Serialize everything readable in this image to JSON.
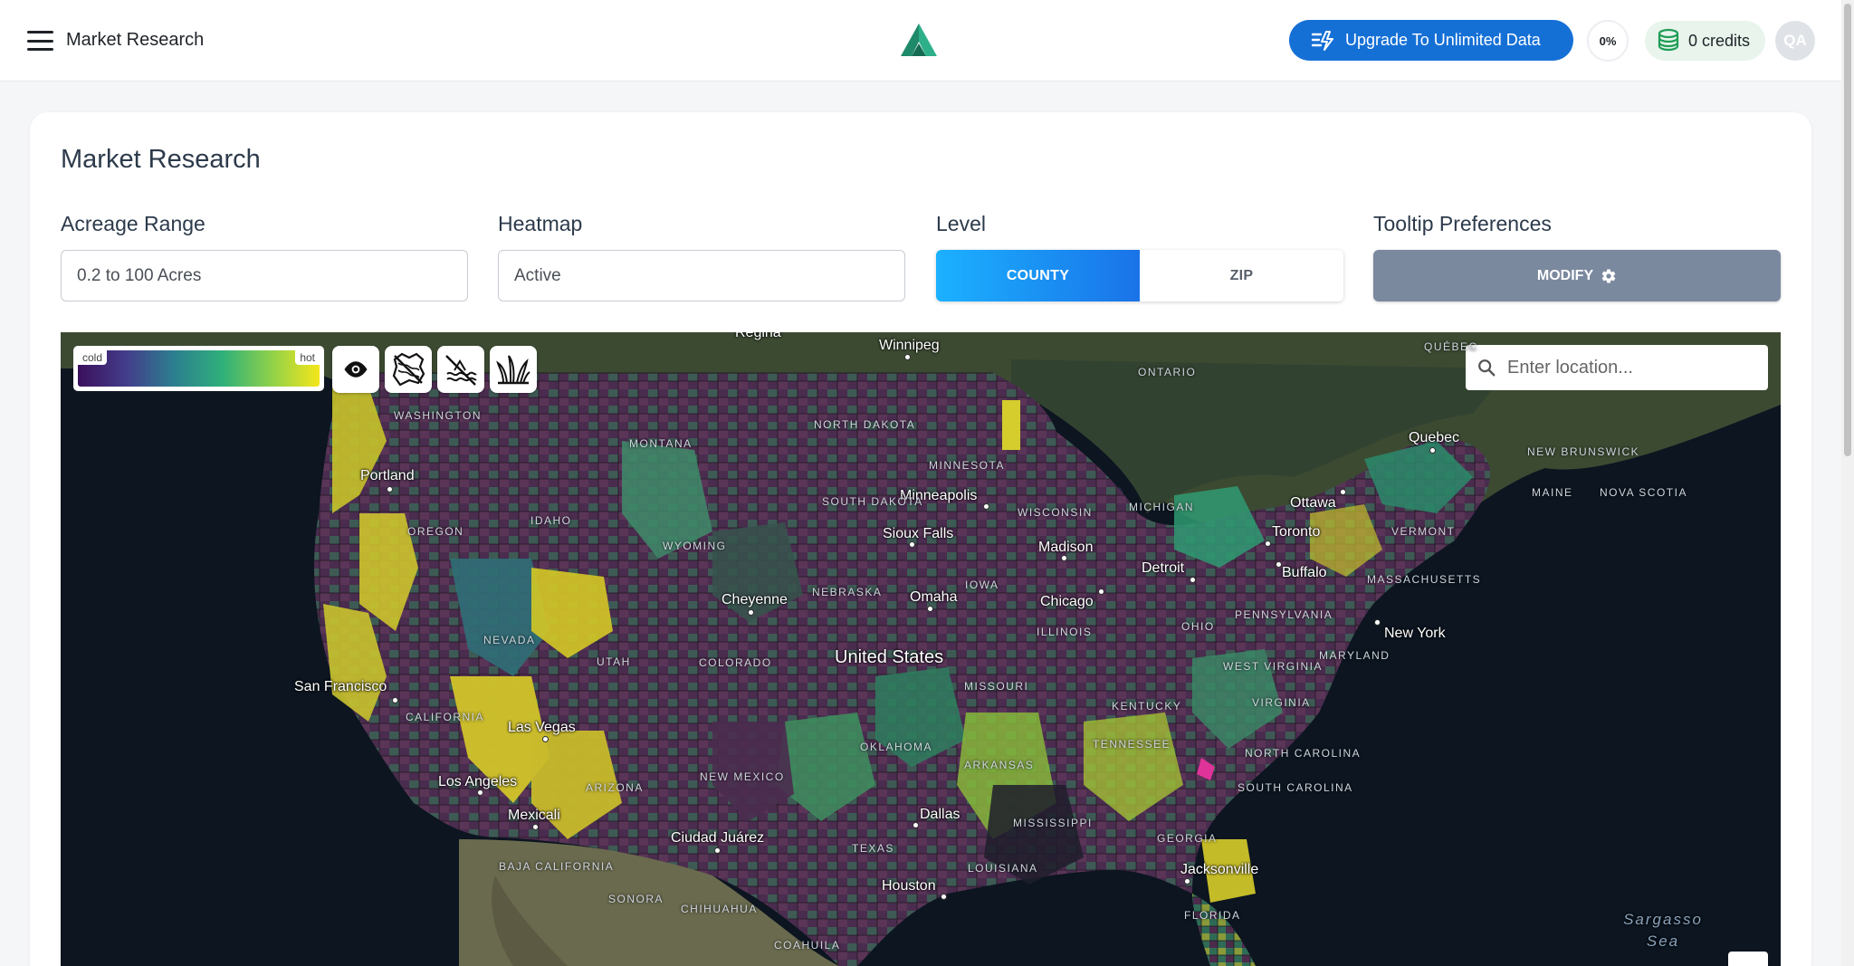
{
  "header": {
    "app_title": "Market Research",
    "upgrade_label": "Upgrade To Unlimited Data",
    "progress_text": "0%",
    "progress_value": 0,
    "credits_label": "0 credits",
    "avatar_initials": "QA"
  },
  "page": {
    "title": "Market Research"
  },
  "filters": {
    "acreage": {
      "label": "Acreage Range",
      "value": "0.2 to 100 Acres"
    },
    "heatmap": {
      "label": "Heatmap",
      "value": "Active"
    },
    "level": {
      "label": "Level",
      "options": [
        "COUNTY",
        "ZIP"
      ],
      "selected": "COUNTY"
    },
    "tooltip": {
      "label": "Tooltip Preferences",
      "button_label": "MODIFY"
    }
  },
  "map": {
    "legend": {
      "cold_label": "cold",
      "hot_label": "hot"
    },
    "layer_icons": [
      "eye-icon",
      "no-flood-zone-icon",
      "no-wetland-icon",
      "vegetation-icon"
    ],
    "search_placeholder": "Enter location...",
    "country_label": "United States",
    "cities": [
      "Regina",
      "Winnipeg",
      "Portland",
      "Minneapolis",
      "Sioux Falls",
      "Madison",
      "Ottawa",
      "Quebec",
      "Toronto",
      "Buffalo",
      "Detroit",
      "Chicago",
      "Omaha",
      "Cheyenne",
      "New York",
      "San Francisco",
      "Las Vegas",
      "Los Angeles",
      "Mexicali",
      "Ciudad Juárez",
      "Dallas",
      "Houston",
      "Jacksonville"
    ],
    "regions": [
      "WASHINGTON",
      "MONTANA",
      "NORTH DAKOTA",
      "MINNESOTA",
      "ONTARIO",
      "QUÉBEC",
      "NEW BRUNSWICK",
      "NOVA SCOTIA",
      "MAINE",
      "VERMONT",
      "MASSACHUSETTS",
      "OREGON",
      "IDAHO",
      "SOUTH DAKOTA",
      "WYOMING",
      "WISCONSIN",
      "MICHIGAN",
      "NEBRASKA",
      "IOWA",
      "PENNSYLVANIA",
      "NEVADA",
      "UTAH",
      "COLORADO",
      "ILLINOIS",
      "OHIO",
      "WEST VIRGINIA",
      "MARYLAND",
      "CALIFORNIA",
      "MISSOURI",
      "KENTUCKY",
      "VIRGINIA",
      "OKLAHOMA",
      "TENNESSEE",
      "NORTH CAROLINA",
      "ARKANSAS",
      "ARIZONA",
      "NEW MEXICO",
      "SOUTH CAROLINA",
      "MISSISSIPPI",
      "GEORGIA",
      "TEXAS",
      "LOUISIANA",
      "BAJA CALIFORNIA",
      "SONORA",
      "CHIHUAHUA",
      "COAHUILA",
      "FLORIDA"
    ],
    "sea_label": "Sargasso Sea"
  },
  "colors": {
    "primary": "#1570d6",
    "level_active_start": "#1bb1ff",
    "level_active_end": "#1a73e8",
    "modify_bg": "#7b899f",
    "credits_bg": "#e8f4ec",
    "heat_cold": "#3b0f5c",
    "heat_hot": "#f5e61a"
  }
}
